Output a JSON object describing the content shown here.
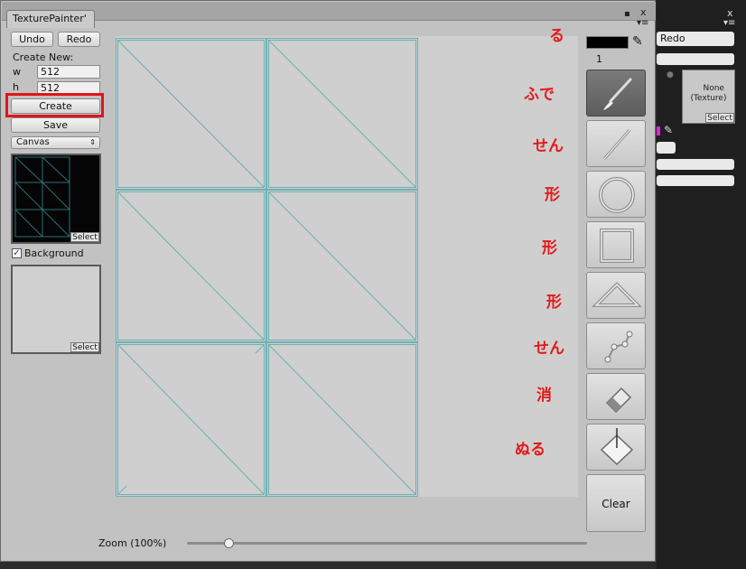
{
  "window": {
    "tab_title": "TexturePainter'",
    "tab_menu_icon": "tab-menu-icon",
    "close_label": "x"
  },
  "left_panel": {
    "undo_label": "Undo",
    "redo_label": "Redo",
    "create_new_label": "Create New:",
    "w_label": "w",
    "w_value": "512",
    "h_label": "h",
    "h_value": "512",
    "create_label": "Create",
    "save_label": "Save",
    "mode_select_value": "Canvas",
    "select_label": "Select",
    "background_label": "Background",
    "background_checked": true
  },
  "tools": {
    "color_swatch": "#000000",
    "brush_size": "1",
    "clear_label": "Clear",
    "items": [
      {
        "name": "brush",
        "icon": "brush-icon",
        "active": true
      },
      {
        "name": "line",
        "icon": "line-icon"
      },
      {
        "name": "circle",
        "icon": "circle-icon"
      },
      {
        "name": "rectangle",
        "icon": "rectangle-icon"
      },
      {
        "name": "triangle",
        "icon": "triangle-icon"
      },
      {
        "name": "polyline",
        "icon": "polyline-icon"
      },
      {
        "name": "eraser",
        "icon": "eraser-icon"
      },
      {
        "name": "fill",
        "icon": "fill-bucket-icon"
      }
    ]
  },
  "annotations": [
    "る",
    "ふで",
    "せん",
    "形",
    "形",
    "形",
    "せん",
    "消",
    "ぬる"
  ],
  "zoom": {
    "label": "Zoom (100%)",
    "value_percent": 100,
    "slider_fraction": 0.1
  },
  "right_panel": {
    "redo_label": "Redo",
    "texture_label": "None\n(Texture)",
    "select_label": "Select",
    "close_label": "x"
  },
  "colors": {
    "highlight": "#e0151b",
    "canvas_lines": "#6cb0b3",
    "active_tool": "#666666"
  }
}
